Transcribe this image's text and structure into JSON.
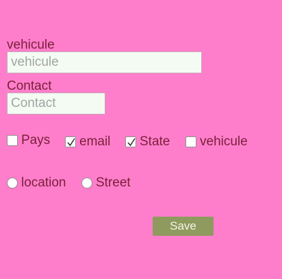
{
  "form": {
    "vehicule_field": {
      "label": "vehicule",
      "value": "",
      "placeholder": "vehicule"
    },
    "contact_field": {
      "label": "Contact",
      "value": "",
      "placeholder": "Contact"
    },
    "checkboxes": [
      {
        "label": "Pays",
        "checked": false
      },
      {
        "label": "email",
        "checked": true
      },
      {
        "label": "State",
        "checked": true
      },
      {
        "label": "vehicule",
        "checked": false
      }
    ],
    "radios": [
      {
        "label": "location",
        "selected": false
      },
      {
        "label": "Street",
        "selected": false
      }
    ],
    "save_label": "Save"
  },
  "colors": {
    "background": "#ff7ecb",
    "text": "#7a1f3a",
    "input_background": "#f3fbf3",
    "button_background": "#8f9a5f",
    "button_text": "#f4f4e6"
  }
}
